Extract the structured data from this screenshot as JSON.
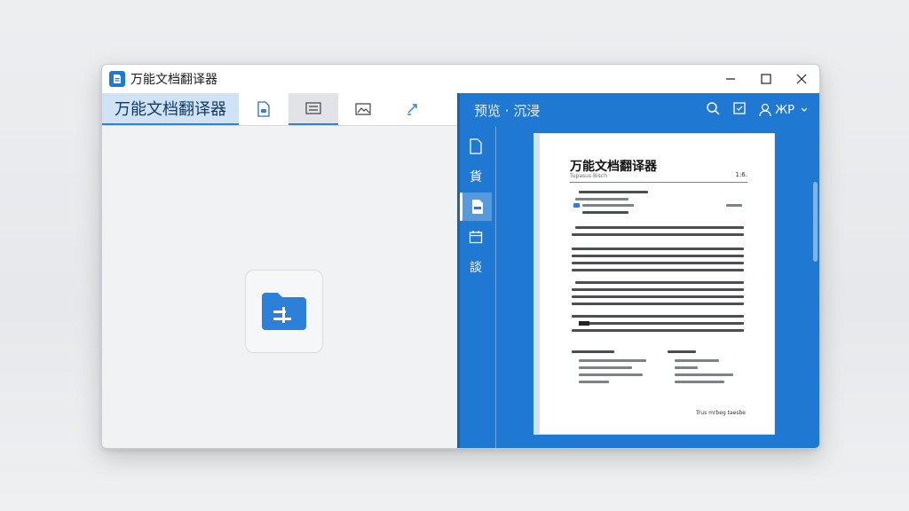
{
  "window": {
    "title": "万能文档翻译器",
    "controls": {
      "minimize": "—",
      "maximize": "☐",
      "close": "✕"
    }
  },
  "left": {
    "brand": "万能文档翻译器",
    "tools": [
      {
        "icon": "document-icon",
        "active": false
      },
      {
        "icon": "list-view-icon",
        "active": true
      },
      {
        "icon": "image-icon",
        "active": false
      },
      {
        "icon": "translate-arrows-icon",
        "active": false
      }
    ],
    "upload_icon": "folder-add-icon"
  },
  "right": {
    "title": "预览 · 沉浸",
    "user_label": "ЖР",
    "rail": [
      {
        "label": "",
        "icon": "file-icon"
      },
      {
        "label": "貨",
        "icon": "text-icon"
      },
      {
        "label": "",
        "icon": "pdf-file-icon",
        "active": true
      },
      {
        "label": "",
        "icon": "calendar-icon"
      },
      {
        "label": "談",
        "icon": "text-icon"
      }
    ],
    "document": {
      "title": "万能文档翻译器",
      "subtitle": "Tupasus Bisch",
      "page_no": "1:6.",
      "footer": "Trus mrbeg taesbe"
    }
  },
  "colors": {
    "accent": "#1f78d1",
    "brand_tab": "#cfe2f6"
  }
}
